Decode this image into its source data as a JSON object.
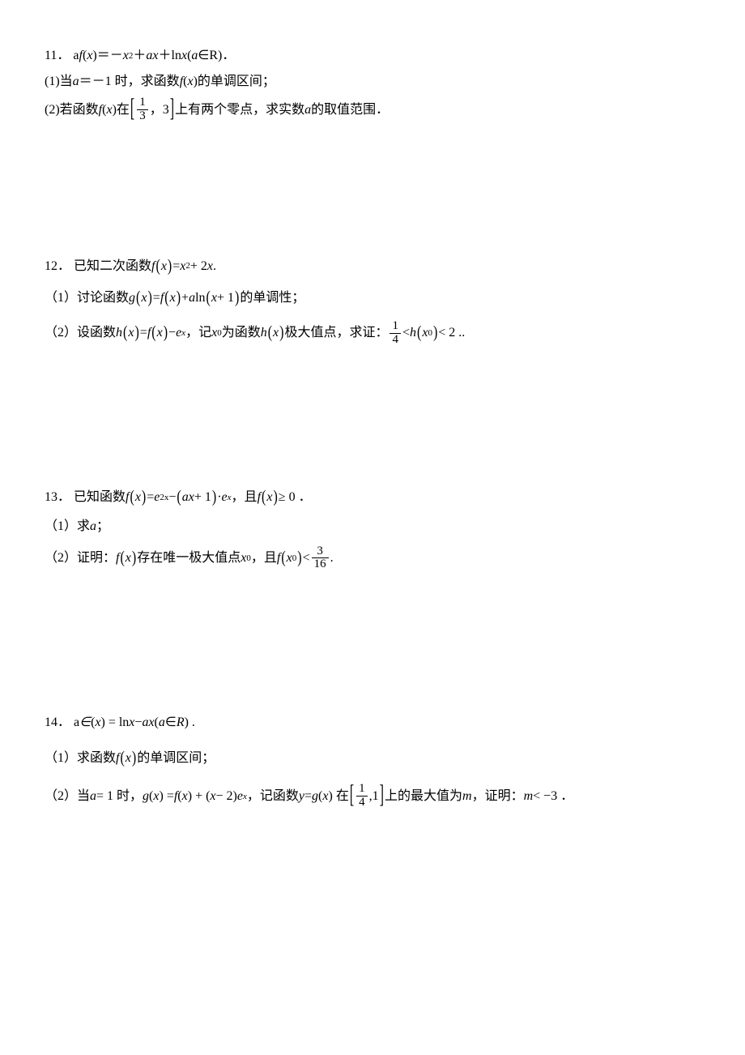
{
  "p11": {
    "num": "11．",
    "stem_a": "a",
    "stem_fx": "f",
    "stem_b": "(",
    "stem_x": "x",
    "stem_c": ")＝－",
    "stem_x2": "x",
    "stem_sq": "2",
    "stem_d": "＋",
    "stem_ax_a": "a",
    "stem_ax_x": "x",
    "stem_e": "＋ln ",
    "stem_lnx": "x",
    "stem_f": "(",
    "stem_g": "∈R)．",
    "q1_a": "(1)当 ",
    "q1_var": "a",
    "q1_b": "＝－1 时，求函数 ",
    "q1_fx": "f",
    "q1_c": "(",
    "q1_x": "x",
    "q1_d": ")的单调区间；",
    "q2_a": "(2)若函数 ",
    "q2_fx": "f",
    "q2_b": "(",
    "q2_x": "x",
    "q2_c": ")在",
    "q2_fn": "1",
    "q2_fd": "3",
    "q2_d": "，3",
    "q2_e": "上有两个零点，求实数 ",
    "q2_var": "a",
    "q2_f": " 的取值范围．"
  },
  "p12": {
    "num": "12．",
    "stem_a": "已知二次函数 ",
    "stem_f": "f",
    "stem_lp": "(",
    "stem_x": "x",
    "stem_rp": ")",
    "stem_eq": " = ",
    "stem_x1": "x",
    "stem_sq": "2",
    "stem_plus": " + 2",
    "stem_x2": "x",
    "stem_end": " .",
    "q1_a": "（1）讨论函数 ",
    "q1_g": "g",
    "q1_lp1": "(",
    "q1_x1": "x",
    "q1_rp1": ")",
    "q1_eq": " = ",
    "q1_f": "f",
    "q1_lp2": "(",
    "q1_x2": "x",
    "q1_rp2": ")",
    "q1_plus": " + ",
    "q1_a_var": "a",
    "q1_ln": " ln",
    "q1_lp3": "(",
    "q1_x3": "x",
    "q1_pl1": " + 1",
    "q1_rp3": ")",
    "q1_end": " 的单调性；",
    "q2_a": "（2）设函数 ",
    "q2_h": "h",
    "q2_lp1": "(",
    "q2_x1": "x",
    "q2_rp1": ")",
    "q2_eq": " = ",
    "q2_f": "f",
    "q2_lp2": "(",
    "q2_x2": "x",
    "q2_rp2": ")",
    "q2_minus": " − ",
    "q2_e": "e",
    "q2_ex": "x",
    "q2_b": "，记 ",
    "q2_x0": "x",
    "q2_sub0": "0",
    "q2_c": " 为函数 ",
    "q2_h2": "h",
    "q2_lp3": "(",
    "q2_x3": "x",
    "q2_rp3": ")",
    "q2_d": " 极大值点，求证：",
    "q2_fn": "1",
    "q2_fd": "4",
    "q2_lt1": " < ",
    "q2_h3": "h",
    "q2_lp4": "(",
    "q2_x4": "x",
    "q2_sub4": "0",
    "q2_rp4": ")",
    "q2_lt2": " < 2 .."
  },
  "p13": {
    "num": "13．",
    "stem_a": "已知函数 ",
    "stem_f": "f",
    "stem_lp": "(",
    "stem_x": "x",
    "stem_rp": ")",
    "stem_eq": " = ",
    "stem_e": "e",
    "stem_2x": "2x",
    "stem_minus": " − ",
    "stem_lp2": "(",
    "stem_ax_a": "a",
    "stem_ax_x": "x",
    "stem_pl1": " + 1",
    "stem_rp2": ")",
    "stem_dot": "·",
    "stem_e2": "e",
    "stem_ex": "x",
    "stem_b": "，且 ",
    "stem_f2": "f",
    "stem_lp3": "(",
    "stem_x3": "x",
    "stem_rp3": ")",
    "stem_ge": " ≥ 0 ．",
    "q1_a": "（1）求 ",
    "q1_var": "a",
    "q1_b": "；",
    "q2_a": "（2）证明：",
    "q2_f": "f",
    "q2_lp1": "(",
    "q2_x1": "x",
    "q2_rp1": ")",
    "q2_b": " 存在唯一极大值点 ",
    "q2_x0": "x",
    "q2_sub0": "0",
    "q2_c": "，且 ",
    "q2_f2": "f",
    "q2_lp2": "(",
    "q2_x2": "x",
    "q2_sub2": "0",
    "q2_rp2": ")",
    "q2_lt": " < ",
    "q2_fn": "3",
    "q2_fd": "16",
    "q2_end": "."
  },
  "p14": {
    "num": "14．",
    "stem_a": "a",
    "stem_f": " ∈ ",
    "stem_b": " (",
    "stem_x": "x",
    "stem_c": ") = ln ",
    "stem_x2": "x",
    "stem_d": " − ",
    "stem_ax_a": "a",
    "stem_ax_x": "x",
    "stem_e": "(",
    "stem_R": "R",
    "stem_g": ") .",
    "q1_a": "（1）求函数 ",
    "q1_f": "f",
    "q1_lp": "(",
    "q1_x": "x",
    "q1_rp": ")",
    "q1_b": " 的单调区间；",
    "q2_a": "（2）当 ",
    "q2_var": "a",
    "q2_b": " = 1 时，",
    "q2_g": "g",
    "q2_c": "(",
    "q2_x1": "x",
    "q2_d": ") = ",
    "q2_f": "f",
    "q2_e": " (",
    "q2_x2": "x",
    "q2_ff": ") + (",
    "q2_x3": "x",
    "q2_g2": " − 2)",
    "q2_ee": "e",
    "q2_ex": "x",
    "q2_h": "，记函数 ",
    "q2_y": "y",
    "q2_i": " = ",
    "q2_g3": "g",
    "q2_j": "(",
    "q2_x4": "x",
    "q2_k": ") 在",
    "q2_fn": "1",
    "q2_fd": "4",
    "q2_l": ",1",
    "q2_m": "上的最大值为 ",
    "q2_mm": "m",
    "q2_n": " ，证明：",
    "q2_mm2": "m",
    "q2_o": " < −3 ．"
  }
}
